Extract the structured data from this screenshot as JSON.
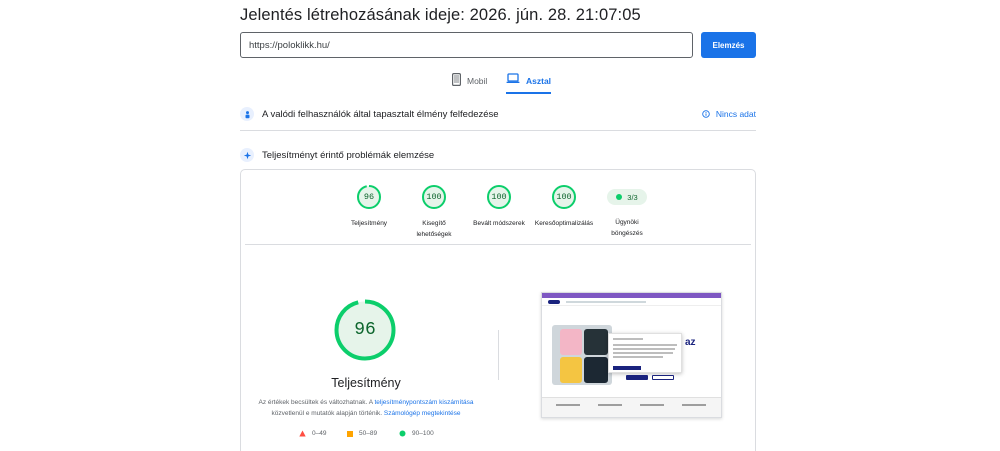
{
  "header": {
    "title": "Jelentés létrehozásának ideje: 2026. jún. 28. 21:07:05"
  },
  "search": {
    "url_value": "https://poloklikk.hu/",
    "analyze_label": "Elemzés"
  },
  "tabs": [
    {
      "label": "Mobil",
      "active": false
    },
    {
      "label": "Asztal",
      "active": true
    }
  ],
  "crux_section": {
    "title": "A valódi felhasználók által tapasztalt élmény felfedezése",
    "no_data_label": "Nincs adat"
  },
  "diagnostics_section": {
    "title": "Teljesítményt érintő problémák elemzése"
  },
  "scores": [
    {
      "value": "96",
      "fraction": 0.96,
      "label": "Teljesítmény"
    },
    {
      "value": "100",
      "fraction": 1.0,
      "label": "Kisegítő lehetőségek"
    },
    {
      "value": "100",
      "fraction": 1.0,
      "label": "Bevált módszerek"
    },
    {
      "value": "100",
      "fraction": 1.0,
      "label": "Keresőoptimalizálás"
    }
  ],
  "agent": {
    "value": "3/3",
    "label": "Ügynöki böngészés"
  },
  "performance": {
    "value": "96",
    "fraction": 0.96,
    "title": "Teljesítmény",
    "desc_before": "Az értékek becsültek és változhatnak. A ",
    "desc_link1": "teljesítménypontszám kiszámítása",
    "desc_middle": " közvetlenül e mutatók alapján történik. ",
    "desc_link2": "Számológép megtekintése"
  },
  "legend": [
    {
      "range": "0–49",
      "color": "#ff4e42"
    },
    {
      "range": "50–89",
      "color": "#ffa400"
    },
    {
      "range": "90–100",
      "color": "#0cce6b"
    }
  ],
  "thumbnail": {
    "headline": "az"
  },
  "colors": {
    "accent": "#1a73e8",
    "pass": "#0cce6b",
    "pass_text": "#0d652d"
  }
}
